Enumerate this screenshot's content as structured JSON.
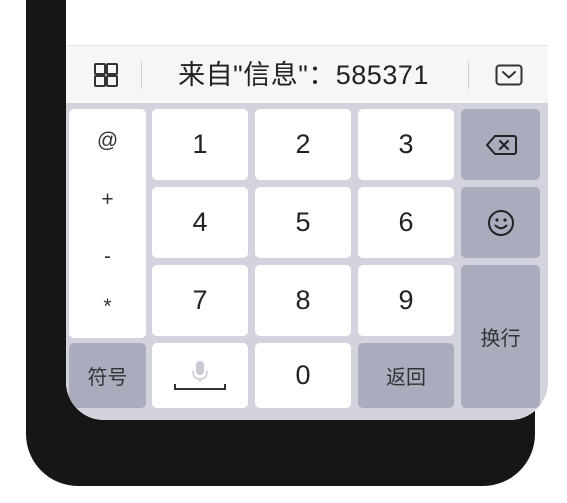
{
  "suggestion_bar": {
    "text": "来自\"信息\"：585371",
    "left_icon": "grid-icon",
    "right_icon": "keyboard-collapse-icon"
  },
  "keyboard": {
    "symbols": [
      "@",
      "+",
      "-",
      "*"
    ],
    "digits": [
      "1",
      "2",
      "3",
      "4",
      "5",
      "6",
      "7",
      "8",
      "9"
    ],
    "zero": "0",
    "symbol_key_label": "符号",
    "return_key_label": "返回",
    "enter_key_label": "换行",
    "backspace_icon": "backspace-icon",
    "emoji_icon": "emoji-icon",
    "voice_icon": "microphone-icon"
  },
  "colors": {
    "keyboard_bg": "#d2d3dd",
    "key_white": "#ffffff",
    "key_gray": "#a9acbd",
    "frame": "#161616"
  }
}
